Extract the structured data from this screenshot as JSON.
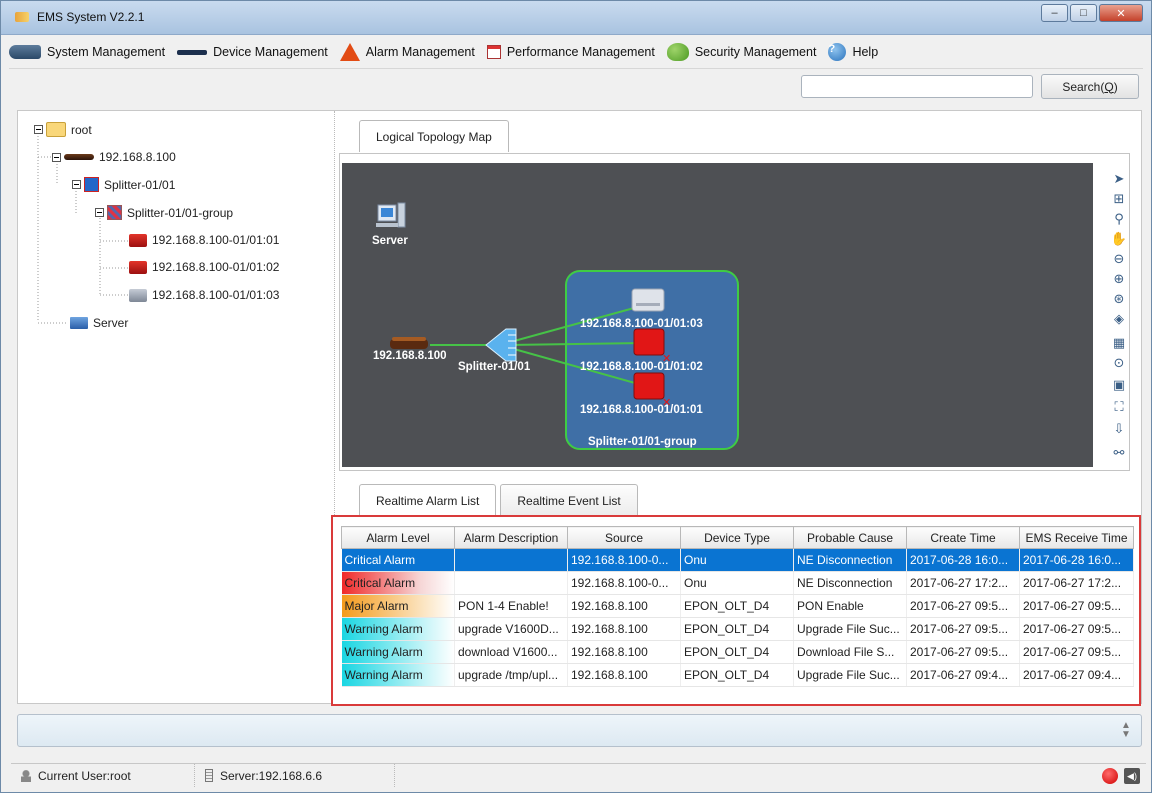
{
  "window": {
    "title": "EMS System V2.2.1",
    "controls": {
      "minimize": "‒",
      "maximize": "□",
      "close": "✕"
    }
  },
  "menu": [
    {
      "label": "System Management",
      "icon": "system-icon"
    },
    {
      "label": "Device Management",
      "icon": "device-icon"
    },
    {
      "label": "Alarm Management",
      "icon": "alarm-icon"
    },
    {
      "label": "Performance Management",
      "icon": "performance-icon"
    },
    {
      "label": "Security Management",
      "icon": "security-icon"
    },
    {
      "label": "Help",
      "icon": "help-icon"
    }
  ],
  "search": {
    "value": "",
    "button_label": "Search(",
    "button_key": "Q",
    "button_tail": ")"
  },
  "tree": {
    "root": "root",
    "olt": "192.168.8.100",
    "splitter": "Splitter-01/01",
    "group": "Splitter-01/01-group",
    "onus": [
      "192.168.8.100-01/01:01",
      "192.168.8.100-01/01:02",
      "192.168.8.100-01/01:03"
    ],
    "server": "Server"
  },
  "topology": {
    "tab_label": "Logical Topology Map",
    "server_label": "Server",
    "olt_label": "192.168.8.100",
    "splitter_label": "Splitter-01/01",
    "group_label": "Splitter-01/01-group",
    "onu_labels": [
      "192.168.8.100-01/01:03",
      "192.168.8.100-01/01:02",
      "192.168.8.100-01/01:01"
    ],
    "tools": [
      "select-arrow-icon",
      "marquee-select-icon",
      "zoom-icon",
      "pan-hand-icon",
      "zoom-out-icon",
      "zoom-in-icon",
      "zoom-fit-icon",
      "fit-window-icon",
      "zoom-area-icon",
      "zoom-reset-icon",
      "overview-icon",
      "fullscreen-icon",
      "export-icon",
      "layout-icon"
    ]
  },
  "alarm_tabs": [
    "Realtime Alarm List",
    "Realtime Event List"
  ],
  "alarm_table": {
    "columns": [
      "Alarm Level",
      "Alarm Description",
      "Source",
      "Device Type",
      "Probable Cause",
      "Create Time",
      "EMS Receive Time"
    ],
    "rows": [
      {
        "level": "Critical Alarm",
        "desc": "",
        "source": "192.168.8.100-0...",
        "type": "Onu",
        "cause": "NE Disconnection",
        "created": "2017-06-28 16:0...",
        "received": "2017-06-28 16:0...",
        "selected": true
      },
      {
        "level": "Critical Alarm",
        "desc": "",
        "source": "192.168.8.100-0...",
        "type": "Onu",
        "cause": "NE Disconnection",
        "created": "2017-06-27 17:2...",
        "received": "2017-06-27 17:2..."
      },
      {
        "level": "Major Alarm",
        "desc": "PON 1-4 Enable!",
        "source": "192.168.8.100",
        "type": "EPON_OLT_D4",
        "cause": "PON Enable",
        "created": "2017-06-27 09:5...",
        "received": "2017-06-27 09:5..."
      },
      {
        "level": "Warning Alarm",
        "desc": "upgrade V1600D...",
        "source": "192.168.8.100",
        "type": "EPON_OLT_D4",
        "cause": "Upgrade File Suc...",
        "created": "2017-06-27 09:5...",
        "received": "2017-06-27 09:5..."
      },
      {
        "level": "Warning Alarm",
        "desc": "download V1600...",
        "source": "192.168.8.100",
        "type": "EPON_OLT_D4",
        "cause": "Download File S...",
        "created": "2017-06-27 09:5...",
        "received": "2017-06-27 09:5..."
      },
      {
        "level": "Warning Alarm",
        "desc": "upgrade /tmp/upl...",
        "source": "192.168.8.100",
        "type": "EPON_OLT_D4",
        "cause": "Upgrade File Suc...",
        "created": "2017-06-27 09:4...",
        "received": "2017-06-27 09:4..."
      }
    ]
  },
  "status": {
    "user": "Current User:root",
    "server": "Server:192.168.6.6"
  },
  "colors": {
    "critical": "#f02a2a",
    "major": "#f49b1c",
    "warning": "#1ad6e2",
    "selected_row": "#0a74d2",
    "highlight_border": "#d93a3a",
    "canvas": "#4e5054"
  }
}
